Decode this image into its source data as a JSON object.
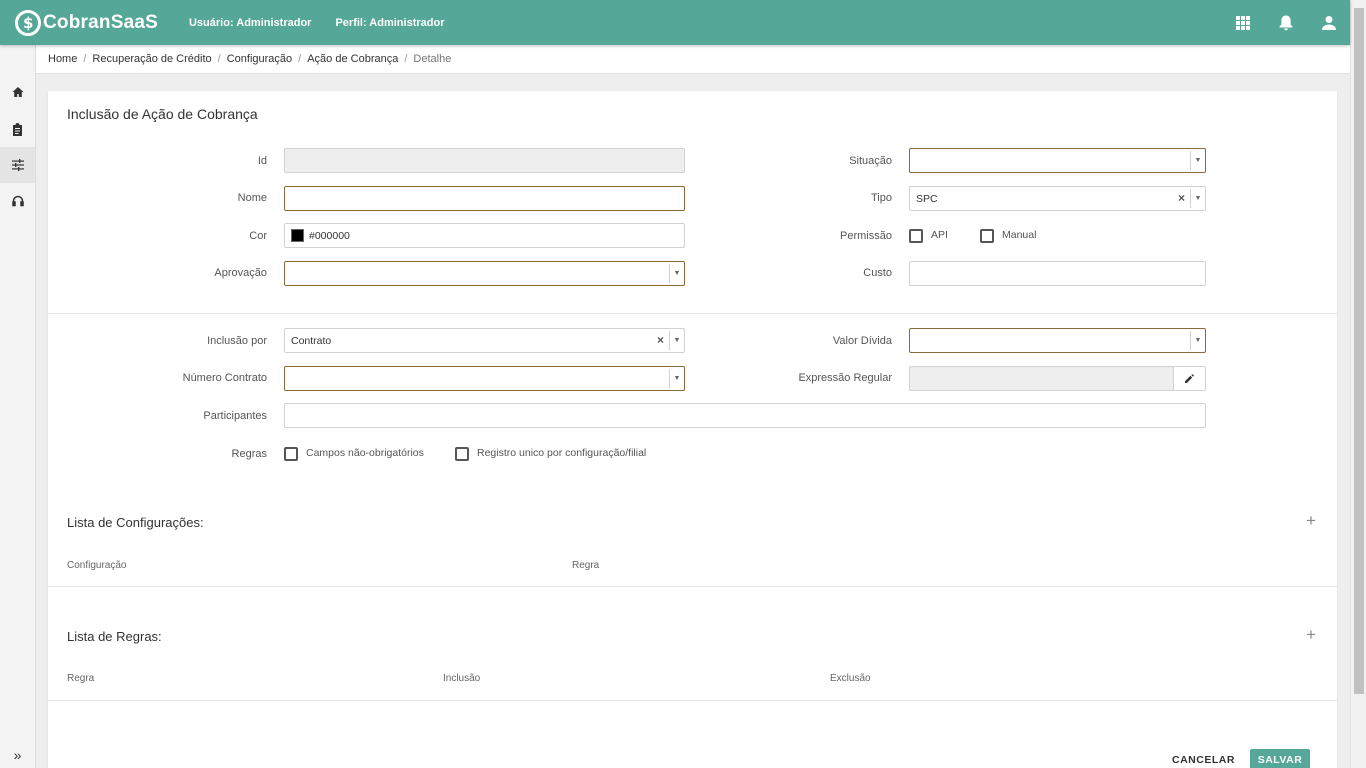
{
  "header": {
    "brand": "CobranSaaS",
    "user_label": "Usuário:",
    "user_value": "Administrador",
    "perfil_label": "Perfil:",
    "perfil_value": "Administrador",
    "icons": [
      "apps-grid-icon",
      "bell-icon",
      "user-icon"
    ],
    "accent_color": "#55a898"
  },
  "sidebar": {
    "items": [
      {
        "icon": "home-icon"
      },
      {
        "icon": "clipboard-icon"
      },
      {
        "icon": "sliders-icon",
        "active": true
      },
      {
        "icon": "headset-icon"
      }
    ],
    "expand": "»"
  },
  "breadcrumb": [
    "Home",
    "Recuperação de Crédito",
    "Configuração",
    "Ação de Cobrança",
    "Detalhe"
  ],
  "form": {
    "title": "Inclusão de Ação de Cobrança",
    "id": {
      "label": "Id",
      "value": ""
    },
    "nome": {
      "label": "Nome",
      "value": ""
    },
    "cor": {
      "label": "Cor",
      "value": "#000000"
    },
    "aprovacao": {
      "label": "Aprovação",
      "value": ""
    },
    "situacao": {
      "label": "Situação",
      "value": ""
    },
    "tipo": {
      "label": "Tipo",
      "value": "SPC"
    },
    "permissao": {
      "label": "Permissão",
      "options": [
        "API",
        "Manual"
      ]
    },
    "custo": {
      "label": "Custo",
      "value": ""
    },
    "inclusao_por": {
      "label": "Inclusão por",
      "value": "Contrato"
    },
    "numero_contrato": {
      "label": "Número Contrato",
      "value": ""
    },
    "participantes": {
      "label": "Participantes",
      "value": ""
    },
    "valor_divida": {
      "label": "Valor Dívida",
      "value": ""
    },
    "expressao_regular": {
      "label": "Expressão Regular",
      "value": ""
    },
    "regras": {
      "label": "Regras",
      "options": [
        "Campos não-obrigatórios",
        "Registro unico por configuração/filial"
      ]
    }
  },
  "lista_configuracoes": {
    "title": "Lista de Configurações:",
    "columns": [
      "Configuração",
      "Regra"
    ]
  },
  "lista_regras": {
    "title": "Lista de Regras:",
    "columns": [
      "Regra",
      "Inclusão",
      "Exclusão"
    ]
  },
  "actions": {
    "cancel": "CANCELAR",
    "save": "SALVAR"
  }
}
